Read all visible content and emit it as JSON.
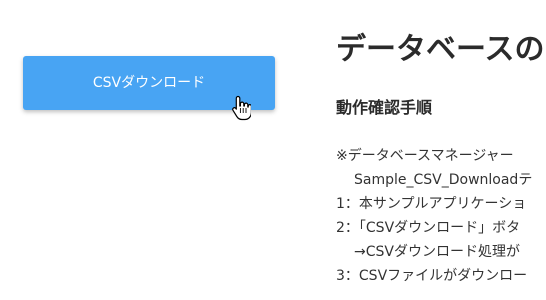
{
  "button": {
    "label": "CSVダウンロード"
  },
  "content": {
    "title": "データベースの",
    "section_heading": "動作確認手順",
    "lines": [
      "※データベースマネージャー",
      "Sample_CSV_Downloadテ",
      "1：本サンプルアプリケーショ",
      "2：「CSVダウンロード」ボタ",
      "→CSVダウンロード処理が",
      "3：CSVファイルがダウンロー"
    ]
  },
  "icons": {
    "cursor": "hand-pointer-cursor-icon"
  },
  "colors": {
    "button_bg": "#48a4f3",
    "button_text": "#ffffff",
    "text": "#333333"
  }
}
